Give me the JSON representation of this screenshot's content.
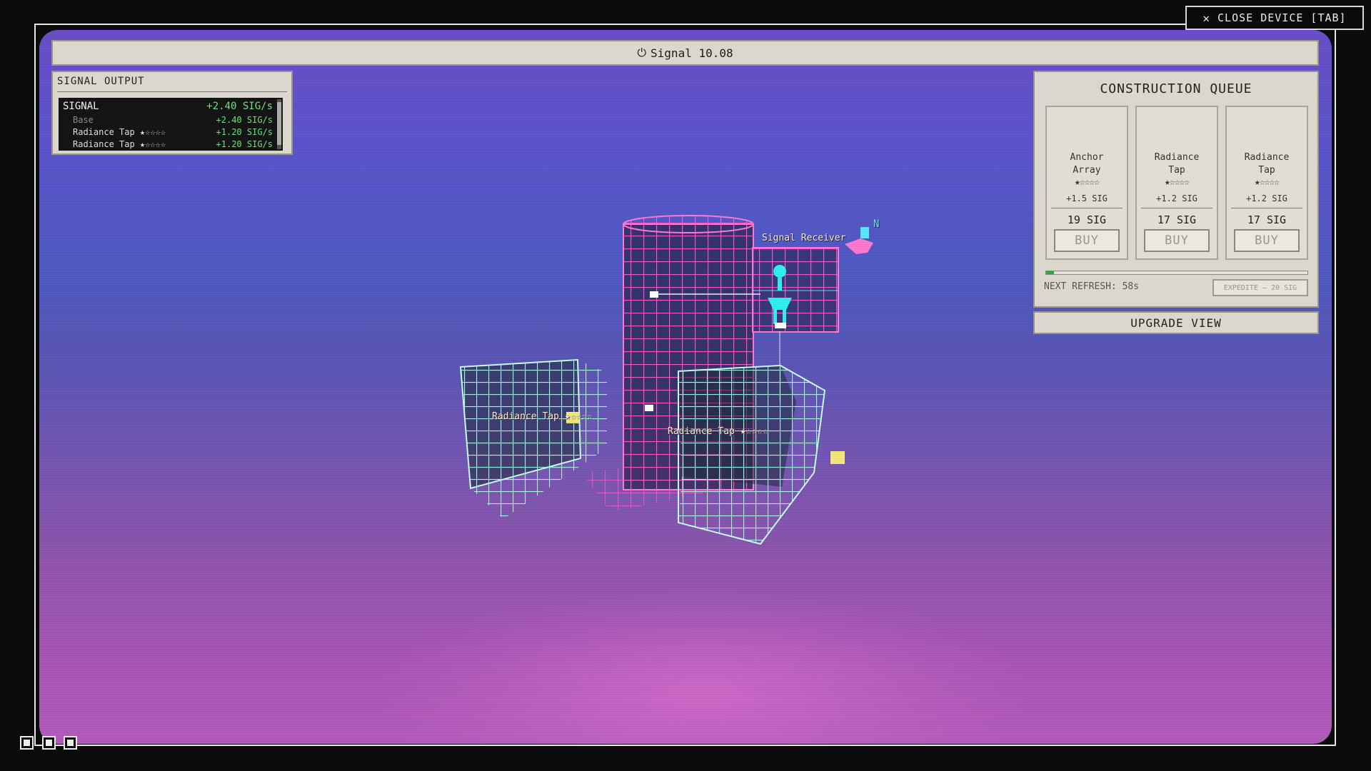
{
  "close_device": {
    "icon": "close-icon",
    "label": "CLOSE DEVICE [TAB]"
  },
  "top_bar": {
    "icon": "power-icon",
    "title": "Signal 10.08"
  },
  "signal_output": {
    "title": "SIGNAL OUTPUT",
    "total": {
      "label": "SIGNAL",
      "value": "+2.40 SIG/s"
    },
    "rows": [
      {
        "label": "Base",
        "value": "+2.40 SIG/s"
      },
      {
        "label": "Radiance Tap ★☆☆☆☆",
        "value": "+1.20 SIG/s"
      },
      {
        "label": "Radiance Tap ★☆☆☆☆",
        "value": "+1.20 SIG/s"
      }
    ]
  },
  "construction_queue": {
    "title": "CONSTRUCTION QUEUE",
    "cards": [
      {
        "name_line1": "Anchor",
        "name_line2": "Array",
        "stars": "★☆☆☆☆",
        "output": "+1.5 SIG",
        "cost": "19 SIG",
        "buy_label": "BUY"
      },
      {
        "name_line1": "Radiance",
        "name_line2": "Tap",
        "stars": "★☆☆☆☆",
        "output": "+1.2 SIG",
        "cost": "17 SIG",
        "buy_label": "BUY"
      },
      {
        "name_line1": "Radiance",
        "name_line2": "Tap",
        "stars": "★☆☆☆☆",
        "output": "+1.2 SIG",
        "cost": "17 SIG",
        "buy_label": "BUY"
      }
    ],
    "refresh_progress": 0.03,
    "next_refresh": "NEXT REFRESH: 58s",
    "expedite_label": "EXPEDITE — 20 SIG"
  },
  "upgrade_view": {
    "label": "UPGRADE VIEW"
  },
  "world_labels": {
    "signal_receiver": "Signal Receiver",
    "tap_left": "Radiance Tap ★☆☆☆☆",
    "tap_right": "Radiance Tap ★☆☆☆☆",
    "antenna": "N"
  },
  "colors": {
    "signal_value": "#6be07b",
    "grid_magenta": "#ff5cc8",
    "grid_teal": "#8ff5df",
    "refresh_fill": "#2fa84a"
  }
}
